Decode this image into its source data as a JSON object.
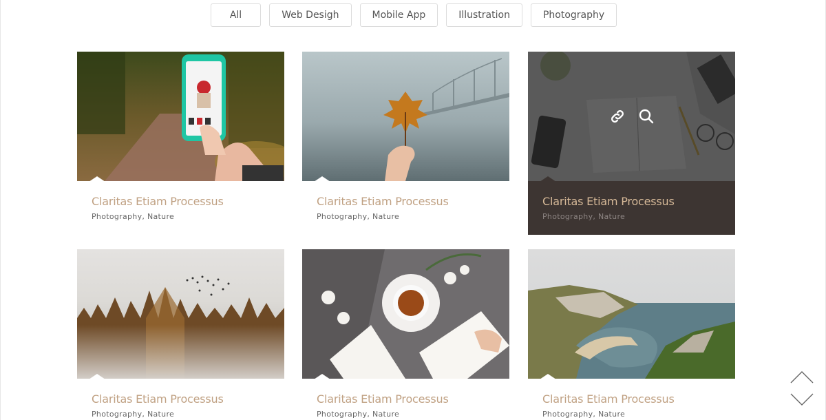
{
  "filters": [
    "All",
    "Web Desigh",
    "Mobile App",
    "Illustration",
    "Photography"
  ],
  "cards": [
    {
      "title": "Claritas Etiam Processus",
      "cat1": "Photography",
      "cat2": "Nature",
      "image": "phone-in-forest"
    },
    {
      "title": "Claritas Etiam Processus",
      "cat1": "Photography",
      "cat2": "Nature",
      "image": "autumn-leaf-bridge"
    },
    {
      "title": "Claritas Etiam Processus",
      "cat1": "Photography",
      "cat2": "Nature",
      "image": "desk-notebook"
    },
    {
      "title": "Claritas Etiam Processus",
      "cat1": "Photography",
      "cat2": "Nature",
      "image": "misty-forest-birds"
    },
    {
      "title": "Claritas Etiam Processus",
      "cat1": "Photography",
      "cat2": "Nature",
      "image": "tea-and-books"
    },
    {
      "title": "Claritas Etiam Processus",
      "cat1": "Photography",
      "cat2": "Nature",
      "image": "coastal-cliffs"
    }
  ],
  "separator": ",",
  "overlay": {
    "link_icon": "link-icon",
    "zoom_icon": "search-icon"
  },
  "scroll": {
    "up_icon": "chevron-up-icon",
    "down_icon": "chevron-down-icon"
  },
  "colors": {
    "title": "#c0a183",
    "active_caption_bg": "#3d3532",
    "category": "#666666"
  }
}
